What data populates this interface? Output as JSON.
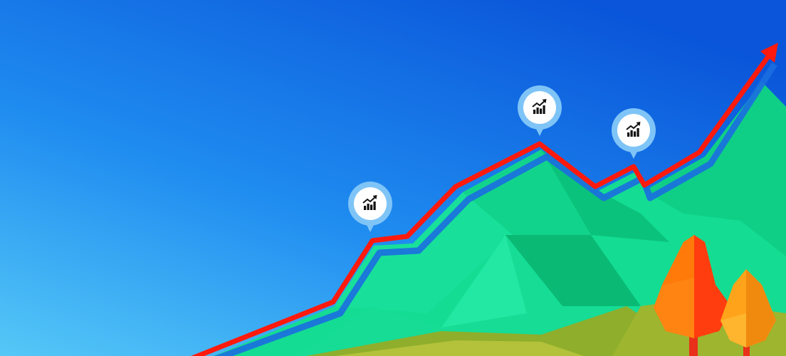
{
  "scene": {
    "description_icons": "chart-trend-icon",
    "colors": {
      "sky_top": "#0a55d9",
      "sky_bottom": "#55c8f7",
      "mountain_light": "#17e39a",
      "mountain_mid": "#0fcf86",
      "mountain_dark": "#08b873",
      "ground_olive": "#8fae2b",
      "trend_line": "#ff1a0d",
      "line_shadow": "#1b6ee0",
      "marker_ring": "#7fc4f7",
      "marker_fill": "#ffffff",
      "tree_orange": "#ff6a00",
      "tree_red": "#ff3d0f",
      "tree_amber": "#ffa41a"
    },
    "markers": [
      {
        "name": "marker-left",
        "icon": "chart-trend-icon"
      },
      {
        "name": "marker-peak",
        "icon": "chart-trend-icon"
      },
      {
        "name": "marker-right",
        "icon": "chart-trend-icon"
      }
    ]
  }
}
